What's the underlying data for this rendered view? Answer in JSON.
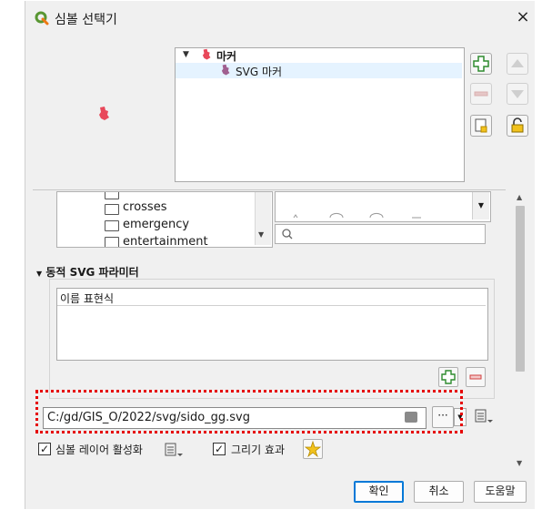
{
  "window": {
    "title": "심볼 선택기",
    "close_label": "×"
  },
  "symbol_tree": {
    "items": [
      {
        "label": "마커",
        "expanded": true
      },
      {
        "label": "SVG 마커",
        "selected": true
      }
    ]
  },
  "svg_categories": [
    "crosses",
    "emergency",
    "entertainment"
  ],
  "search": {
    "placeholder": ""
  },
  "dynamic_params": {
    "section_title": "동적 SVG 파라미터",
    "columns_header": "이름 표현식"
  },
  "path": {
    "value": "C:/gd/GIS_O/2022/svg/sido_gg.svg",
    "browse_label": "···"
  },
  "options": {
    "enable_layer": {
      "label": "심볼 레이어 활성화",
      "checked": true
    },
    "draw_effects": {
      "label": "그리기 효과",
      "checked": true
    }
  },
  "buttons": {
    "ok": "확인",
    "cancel": "취소",
    "help": "도움말"
  },
  "colors": {
    "accent": "#0078d7",
    "highlight": "#e60000",
    "marker": "#e8485a",
    "svg_marker": "#a06090"
  }
}
